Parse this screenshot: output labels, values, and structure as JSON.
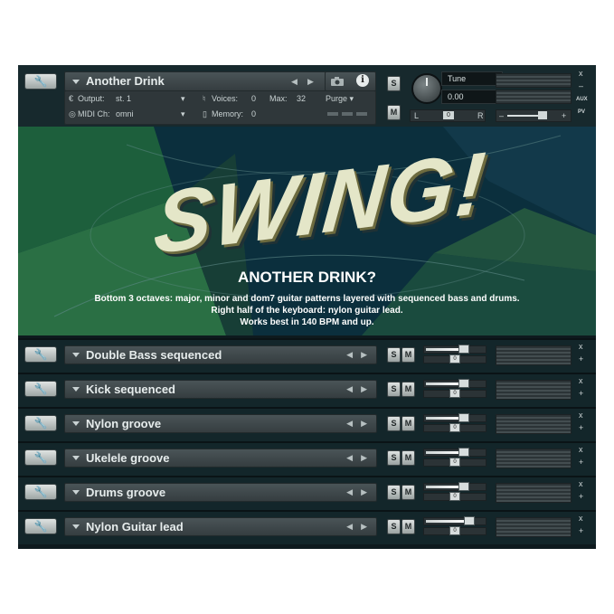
{
  "master": {
    "name": "Another Drink",
    "output_label": "Output:",
    "output_value": "st. 1",
    "midi_label": "MIDI Ch:",
    "midi_value": "omni",
    "voices_label": "Voices:",
    "voices_value": "0",
    "max_label": "Max:",
    "max_value": "32",
    "memory_label": "Memory:",
    "memory_value": "0",
    "purge_label": "Purge",
    "solo_label": "S",
    "mute_label": "M",
    "tune_label": "Tune",
    "tune_value": "0.00",
    "pan_left": "L",
    "pan_right": "R",
    "pan_value": "0",
    "aux_label": "AUX",
    "pv_label": "PV",
    "close_label": "x",
    "minimize_label": "–",
    "info_label": "i",
    "vol_minus": "–",
    "vol_plus": "+"
  },
  "artwork": {
    "logo_text": "SWING!",
    "title": "ANOTHER DRINK?",
    "desc_line1": "Bottom 3 octaves: major, minor and dom7 guitar patterns layered with sequenced bass and drums.",
    "desc_line2": "Right half of the keyboard: nylon guitar lead.",
    "desc_line3": "Works best in 140 BPM and up."
  },
  "instruments": [
    {
      "name": "Double Bass sequenced"
    },
    {
      "name": "Kick sequenced"
    },
    {
      "name": "Nylon groove"
    },
    {
      "name": "Ukelele groove"
    },
    {
      "name": "Drums groove"
    },
    {
      "name": "Nylon Guitar lead"
    }
  ],
  "row_controls": {
    "solo": "S",
    "mute": "M",
    "close": "x",
    "plus": "+",
    "prev": "◀",
    "next": "▶",
    "fader_value": "0"
  },
  "icons": {
    "settings": "wrench-icon",
    "camera": "camera-icon",
    "info": "info-icon",
    "dropdown": "triangle-down-icon"
  },
  "colors": {
    "background": "#0e1a1e",
    "panel": "#3f484b",
    "text": "#e6ecec"
  }
}
